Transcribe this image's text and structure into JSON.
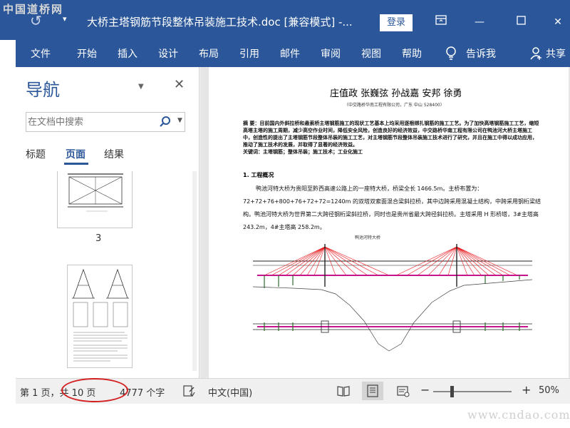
{
  "watermarks": {
    "top": "中国道桥网",
    "bottom": "www.cndao.com"
  },
  "titlebar": {
    "doc_title": "大桥主塔钢筋节段整体吊装施工技术.doc [兼容模式]  -...",
    "login_label": "登录",
    "undo_icon": "undo-icon",
    "qat_more": "▾",
    "controls": [
      "ribbon-display-icon",
      "minimize-icon",
      "maximize-icon",
      "close-icon"
    ]
  },
  "ribbon": {
    "tabs": [
      "文件",
      "开始",
      "插入",
      "设计",
      "布局",
      "引用",
      "邮件",
      "审阅",
      "视图",
      "帮助"
    ],
    "tell_me": "告诉我",
    "share": "共享"
  },
  "nav": {
    "title": "导航",
    "search_placeholder": "在文档中搜索",
    "tabs": [
      "标题",
      "页面",
      "结果"
    ],
    "active_tab": "页面",
    "thumb_page_number": "3"
  },
  "document": {
    "authors": "庄值政  张巍弦  孙战嘉  安邦  徐勇",
    "affiliation": "（中交路桥华南工程有限公司，广东 中山 528400）",
    "abstract": "摘  要：目前国内外斜拉桥和悬索桥主塔钢筋施工的现状工艺基本上均采用逐根绑扎钢筋的施工工艺。为了加快高塔钢筋施工工艺，缩短高塔主塔的施工周期，减少高空作业时间，降低安全风险，创造良好的经济效益，中交路桥华南工程有限公司在鸭池河大桥主塔施工中，创造性的提出了主塔钢筋节段整体吊装的施工工艺，对主塔钢筋节段整体吊装施工技术进行了研究，并且在施工中得以成功应用，推动了施工技术的发展，并取得了显著的经济效益。",
    "keywords": "关键词：主塔钢筋；整体吊装；施工技术；工业化施工",
    "section_heading": "1. 工程概况",
    "body": "鸭池河特大桥为贵阳至黔西高速公路上的一座特大桥，桥梁全长 1466.5m。主桥布置为：72+72+76+800+76+72+72=1240m 的双塔双索面混合梁斜拉桥，其中边跨采用混凝土结构，中跨采用钢桁梁结构。鸭池河特大桥为世界第二大跨径钢桁梁斜拉桥，同时也是贵州省最大跨径斜拉桥。主塔采用 H 形桥塔，3#主塔高 243.2m，4#主塔高 258.2m。",
    "figure_title": "鸭池河特大桥"
  },
  "status": {
    "page_info": "第 1 页，共 10 页",
    "word_count": "4777 个字",
    "language": "中文(中国)",
    "zoom": "50%",
    "zoom_fraction": 0.5,
    "minus": "−",
    "plus": "+"
  },
  "colors": {
    "accent": "#2b579a",
    "highlight": "#d32020",
    "cable": "#e8141a",
    "deck": "#c8148c"
  }
}
